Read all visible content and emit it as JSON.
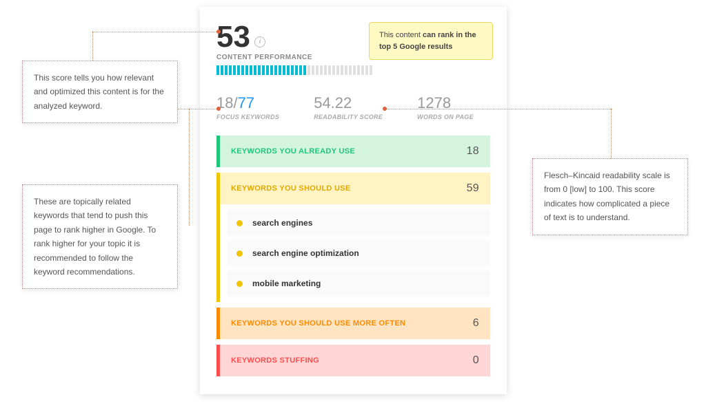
{
  "score": {
    "value": "53",
    "label": "CONTENT PERFORMANCE",
    "progress_filled": 22,
    "progress_total": 38
  },
  "rank_note": {
    "prefix": "This content ",
    "bold": "can rank in the top 5 Google results"
  },
  "stats": {
    "focus": {
      "current": "18",
      "sep": "/",
      "total": "77",
      "label": "FOCUS KEYWORDS"
    },
    "readability": {
      "value": "54.22",
      "label": "READABILITY SCORE"
    },
    "words": {
      "value": "1278",
      "label": "WORDS ON PAGE"
    }
  },
  "sections": {
    "already": {
      "title": "KEYWORDS YOU ALREADY USE",
      "count": "18"
    },
    "should": {
      "title": "KEYWORDS YOU SHOULD USE",
      "count": "59",
      "items": [
        "search engines",
        "search engine optimization",
        "mobile marketing"
      ]
    },
    "more": {
      "title": "KEYWORDS YOU SHOULD USE MORE OFTEN",
      "count": "6"
    },
    "stuff": {
      "title": "KEYWORDS STUFFING",
      "count": "0"
    }
  },
  "callouts": {
    "c1": "This score tells you how relevant and optimized this content is for the analyzed keyword.",
    "c2": "These are topically related keywords that tend to push this page to rank higher in Google. To rank higher for your topic it is recommended to follow the keyword recommendations.",
    "c3": "Flesch–Kincaid readability scale is from 0 [low] to 100. This score indicates how complicated a piece of text is to understand."
  }
}
